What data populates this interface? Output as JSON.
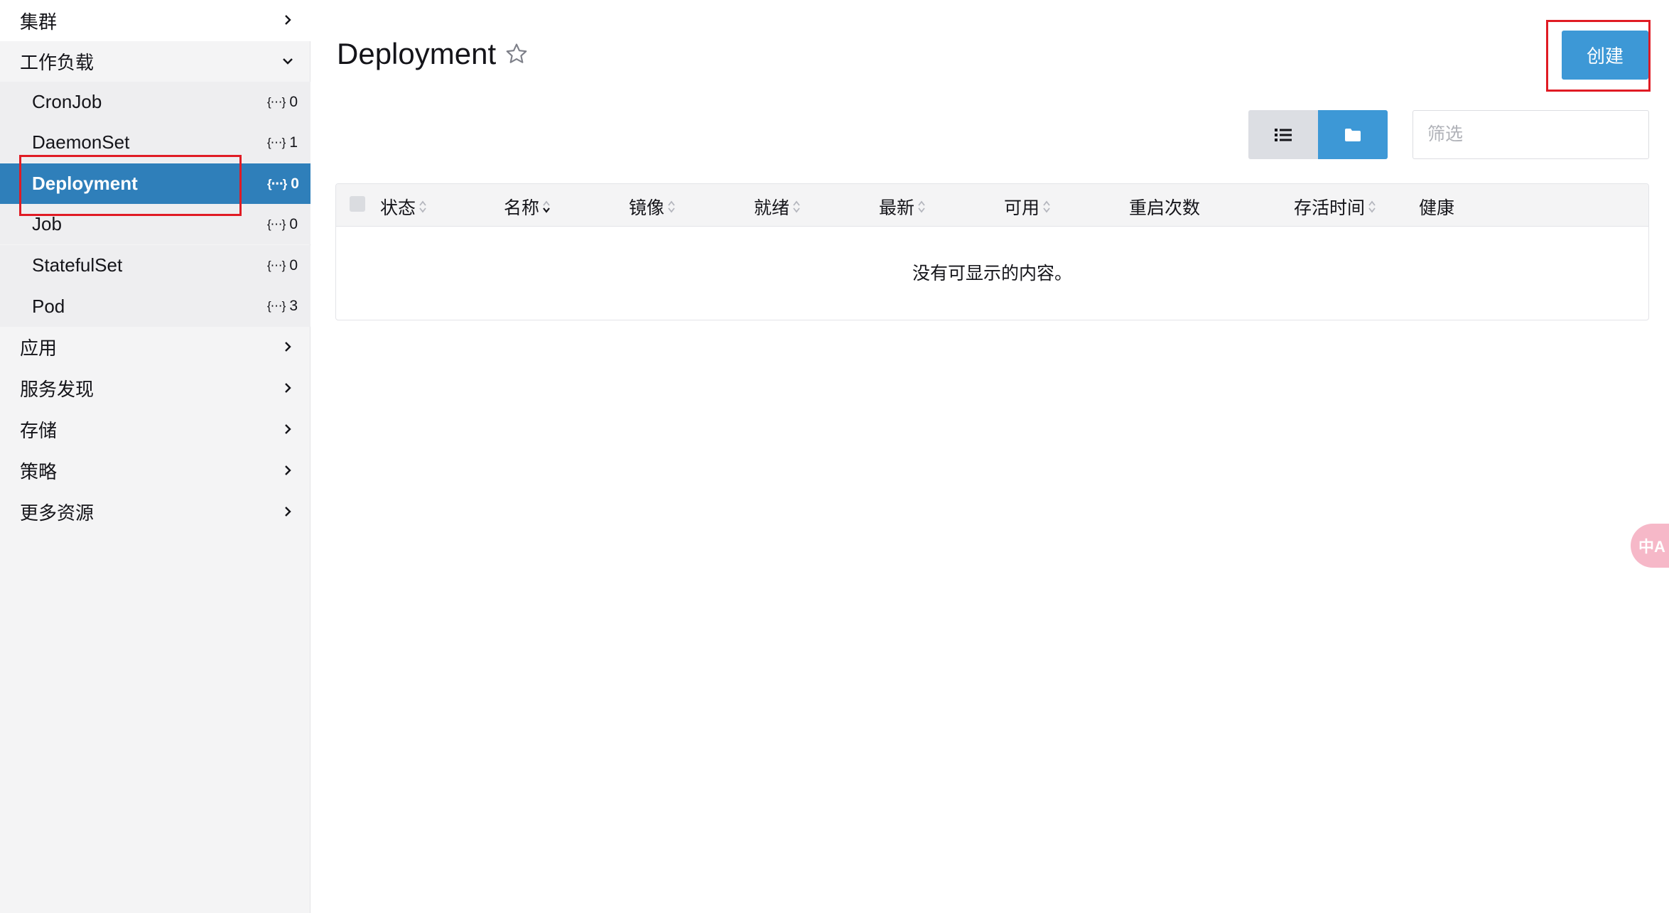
{
  "sidebar": {
    "items": [
      {
        "label": "集群"
      },
      {
        "label": "工作负载"
      },
      {
        "label": "应用"
      },
      {
        "label": "服务发现"
      },
      {
        "label": "存储"
      },
      {
        "label": "策略"
      },
      {
        "label": "更多资源"
      }
    ],
    "workloads": [
      {
        "label": "CronJob",
        "count": "0"
      },
      {
        "label": "DaemonSet",
        "count": "1"
      },
      {
        "label": "Deployment",
        "count": "0",
        "active": true
      },
      {
        "label": "Job",
        "count": "0"
      },
      {
        "label": "StatefulSet",
        "count": "0"
      },
      {
        "label": "Pod",
        "count": "3"
      }
    ],
    "count_icon": "{⋯}"
  },
  "header": {
    "title": "Deployment",
    "create_label": "创建"
  },
  "toolbar": {
    "filter_placeholder": "筛选"
  },
  "table": {
    "columns": [
      "状态",
      "名称",
      "镜像",
      "就绪",
      "最新",
      "可用",
      "重启次数",
      "存活时间",
      "健康"
    ],
    "empty_text": "没有可显示的内容。"
  },
  "fab": {
    "label": "中A"
  },
  "colors": {
    "accent": "#3d98d6",
    "active_nav": "#2f7fba",
    "highlight_box": "#e01b24"
  }
}
